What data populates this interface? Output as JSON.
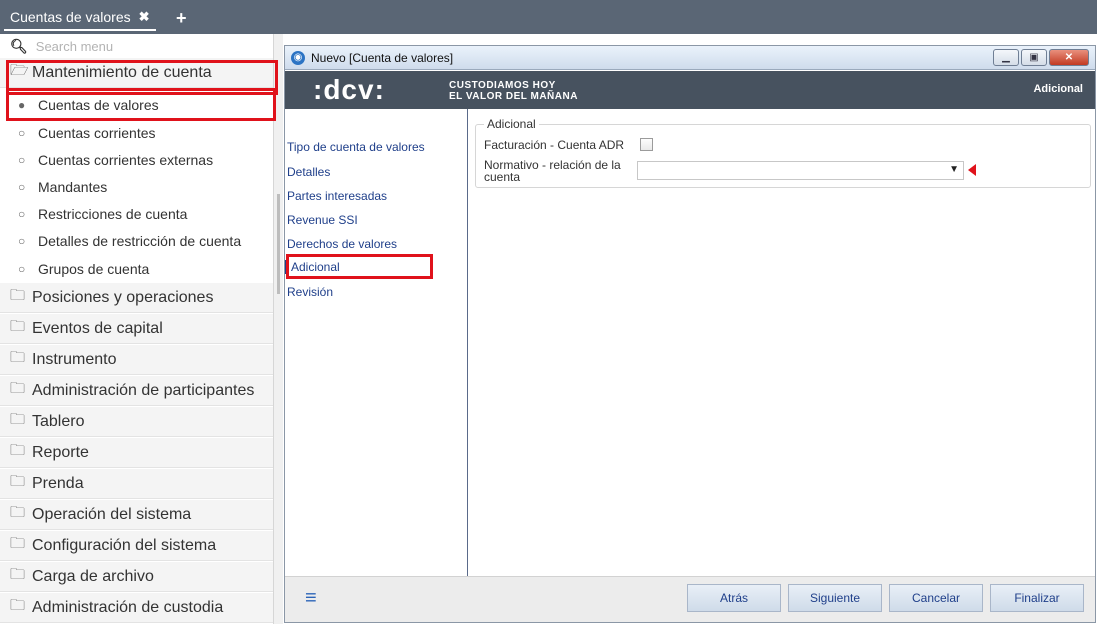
{
  "tabbar": {
    "tab_label": "Cuentas de valores",
    "close_glyph": "✖",
    "add_glyph": "+"
  },
  "sidebar": {
    "search_placeholder": "Search menu",
    "categories": [
      {
        "label": "Mantenimiento de cuenta",
        "icon": "folder-open-icon",
        "expanded": true
      },
      {
        "label": "Posiciones y operaciones",
        "icon": "folder-icon"
      },
      {
        "label": "Eventos de capital",
        "icon": "folder-icon"
      },
      {
        "label": "Instrumento",
        "icon": "folder-icon"
      },
      {
        "label": "Administración de participantes",
        "icon": "folder-icon"
      },
      {
        "label": "Tablero",
        "icon": "folder-icon"
      },
      {
        "label": "Reporte",
        "icon": "folder-icon"
      },
      {
        "label": "Prenda",
        "icon": "folder-icon"
      },
      {
        "label": "Operación del sistema",
        "icon": "folder-icon"
      },
      {
        "label": "Configuración del sistema",
        "icon": "folder-icon"
      },
      {
        "label": "Carga de archivo",
        "icon": "folder-icon"
      },
      {
        "label": "Administración de custodia",
        "icon": "folder-icon"
      }
    ],
    "subitems": [
      {
        "label": "Cuentas de valores",
        "active": true
      },
      {
        "label": "Cuentas corrientes"
      },
      {
        "label": "Cuentas corrientes externas"
      },
      {
        "label": "Mandantes"
      },
      {
        "label": "Restricciones de cuenta"
      },
      {
        "label": "Detalles de restricción de cuenta"
      },
      {
        "label": "Grupos de cuenta"
      }
    ]
  },
  "window": {
    "title": "Nuevo [Cuenta de valores]",
    "banner": {
      "logo_text": ":dcv:",
      "tagline_line1": "CUSTODIAMOS HOY",
      "tagline_line2": "EL VALOR DEL MAÑANA",
      "section": "Adicional"
    },
    "steps": [
      {
        "label": "Tipo de cuenta de valores"
      },
      {
        "label": "Detalles"
      },
      {
        "label": "Partes interesadas"
      },
      {
        "label": "Revenue SSI"
      },
      {
        "label": "Derechos de valores"
      },
      {
        "label": "Adicional",
        "active": true
      },
      {
        "label": "Revisión"
      }
    ],
    "form": {
      "legend": "Adicional",
      "field1_label": "Facturación - Cuenta ADR",
      "field1_checked": false,
      "field2_label_line1": "Normativo - relación de la",
      "field2_label_line2": "cuenta",
      "field2_value": ""
    },
    "footer": {
      "back": "Atrás",
      "next": "Siguiente",
      "cancel": "Cancelar",
      "finish": "Finalizar"
    }
  },
  "colors": {
    "tabbar_bg": "#5a6675",
    "banner_bg": "#47525f",
    "highlight_red": "#e0121b",
    "link_blue": "#1f3f8a"
  }
}
